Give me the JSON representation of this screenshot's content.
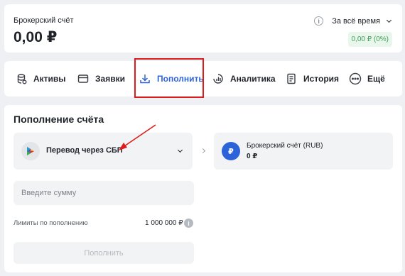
{
  "account": {
    "label": "Брокерский счёт",
    "balance": "0,00 ₽",
    "period": "За всё время",
    "change": "0,00 ₽ (0%)"
  },
  "nav": {
    "tabs": [
      {
        "label": "Активы",
        "icon": "assets-icon"
      },
      {
        "label": "Заявки",
        "icon": "card-icon"
      },
      {
        "label": "Пополнить",
        "icon": "download-icon",
        "active": true
      },
      {
        "label": "Аналитика",
        "icon": "analytics-icon"
      },
      {
        "label": "История",
        "icon": "history-icon"
      },
      {
        "label": "Ещё",
        "icon": "more-icon"
      }
    ]
  },
  "deposit": {
    "title": "Пополнение счёта",
    "method": "Перевод через СБП",
    "target_name": "Брокерский счёт (RUB)",
    "target_amount": "0 ₽",
    "target_badge": "₽",
    "amount_placeholder": "Введите сумму",
    "limits_label": "Лимиты по пополнению",
    "limits_value": "1 000 000 ₽",
    "submit_label": "Пополнить"
  },
  "colors": {
    "accent": "#2d63d8",
    "highlight": "#e01b1b",
    "positive": "#3f9f56"
  }
}
